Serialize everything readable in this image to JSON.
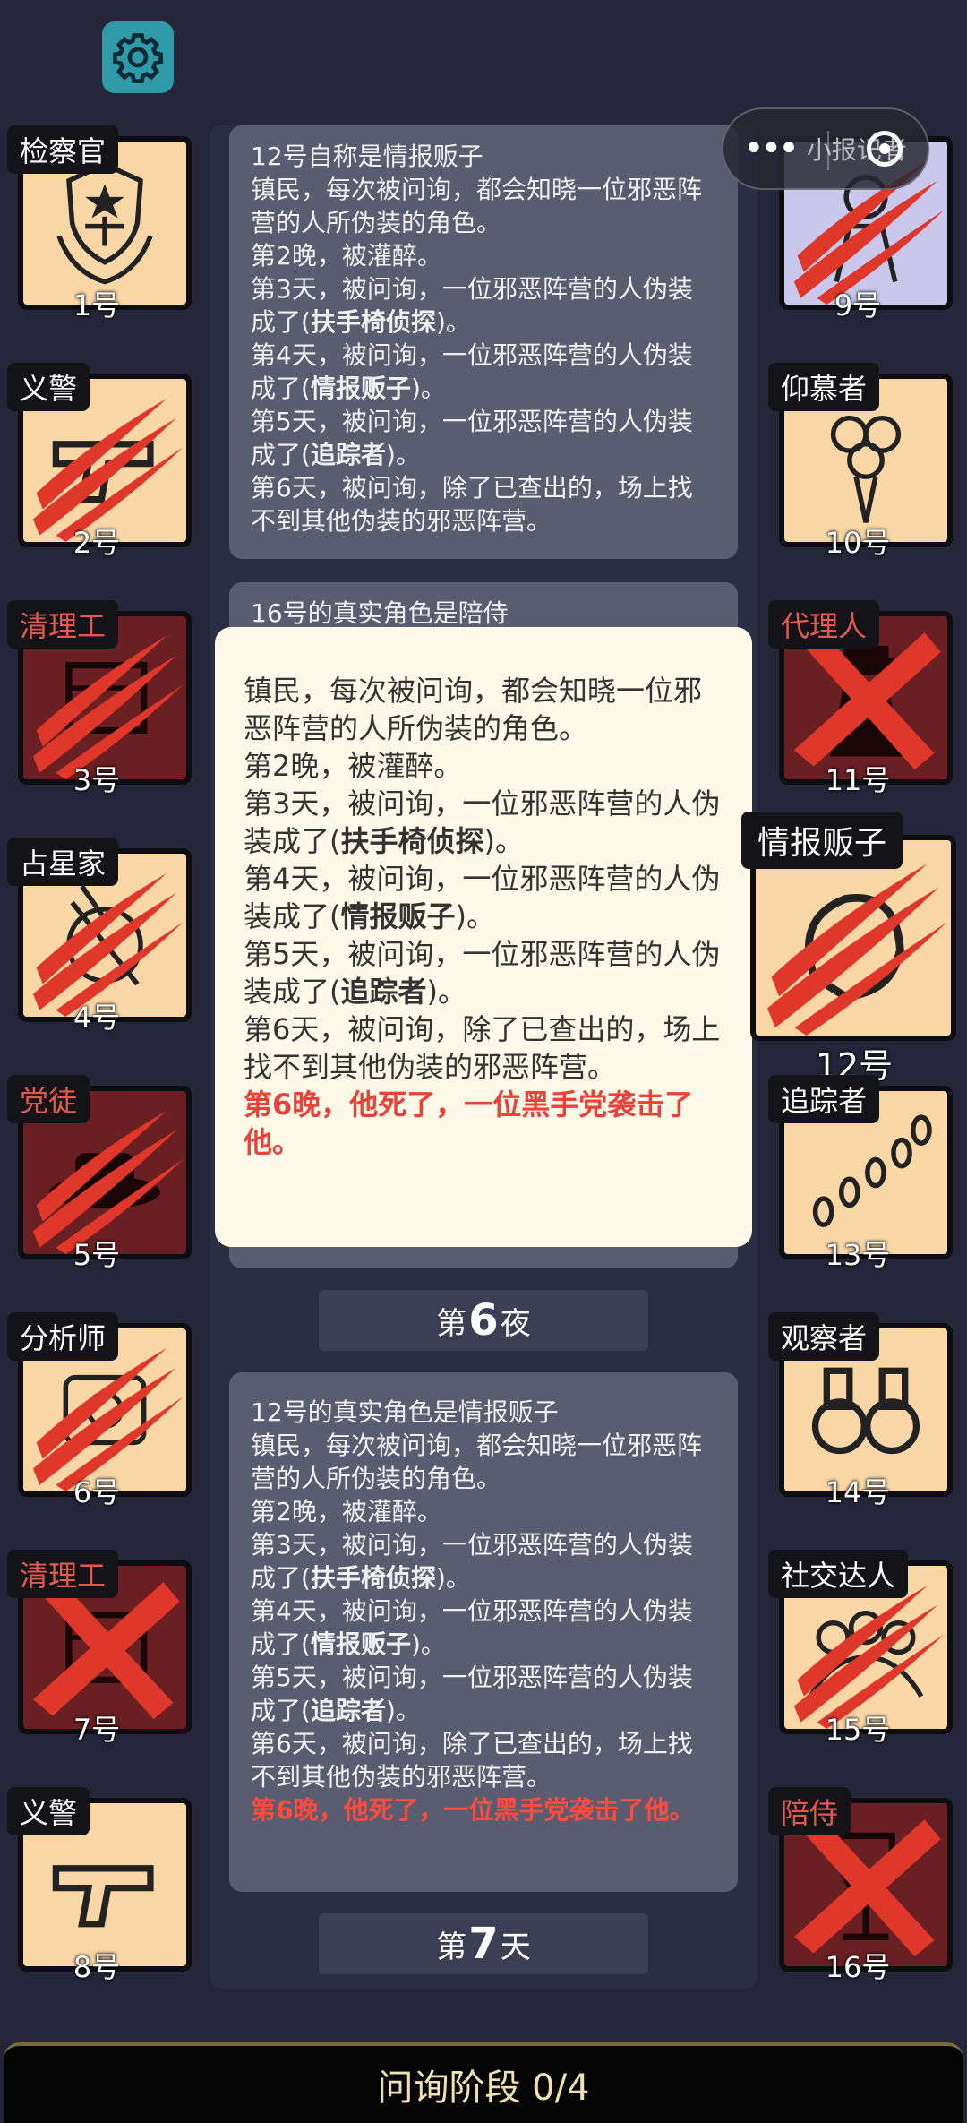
{
  "settings": {
    "icon": "gear-icon"
  },
  "mini_program": {
    "dots": "•••",
    "label": "小报记者",
    "icon": "record-icon"
  },
  "players_left": [
    {
      "seat": "1号",
      "role": "检察官",
      "state": "alive",
      "icon": "prosecutor-badge-icon"
    },
    {
      "seat": "2号",
      "role": "义警",
      "state": "clawed",
      "icon": "pistol-icon"
    },
    {
      "seat": "3号",
      "role": "清理工",
      "state": "clawed-evil",
      "icon": "cleaner-icon"
    },
    {
      "seat": "4号",
      "role": "占星家",
      "state": "clawed",
      "icon": "astrolabe-icon"
    },
    {
      "seat": "5号",
      "role": "党徒",
      "state": "clawed-evil",
      "icon": "hat-icon"
    },
    {
      "seat": "6号",
      "role": "分析师",
      "state": "clawed",
      "icon": "analyst-icon"
    },
    {
      "seat": "7号",
      "role": "清理工",
      "state": "executed-evil",
      "icon": "cleaner-icon"
    },
    {
      "seat": "8号",
      "role": "义警",
      "state": "alive",
      "icon": "pistol-icon"
    }
  ],
  "players_right": [
    {
      "seat": "9号",
      "role": "",
      "state": "clawed-violet",
      "icon": "figure-icon"
    },
    {
      "seat": "10号",
      "role": "仰慕者",
      "state": "alive",
      "icon": "bouquet-icon"
    },
    {
      "seat": "11号",
      "role": "代理人",
      "state": "executed-evil",
      "icon": "agent-icon"
    },
    {
      "seat": "12号",
      "role": "情报贩子",
      "state": "clawed-selected",
      "icon": "informant-icon"
    },
    {
      "seat": "13号",
      "role": "追踪者",
      "state": "alive",
      "icon": "footprints-icon"
    },
    {
      "seat": "14号",
      "role": "观察者",
      "state": "alive",
      "icon": "binoculars-icon"
    },
    {
      "seat": "15号",
      "role": "社交达人",
      "state": "clawed",
      "icon": "crowd-icon"
    },
    {
      "seat": "16号",
      "role": "陪侍",
      "state": "executed-evil",
      "icon": "wineglass-icon"
    }
  ],
  "log_top": {
    "line_claim": "12号自称是情报贩子",
    "line_desc": "镇民，每次被问询，都会知晓一位邪恶阵营的人所伪装的角色。",
    "line_n2": "第2晚，被灌醉。",
    "line_d3_a": "第3天，被问询，一位邪恶阵营的人伪装成了(",
    "line_d3_b": "扶手椅侦探",
    "line_d3_c": ")。",
    "line_d4_a": "第4天，被问询，一位邪恶阵营的人伪装成了(",
    "line_d4_b": "情报贩子",
    "line_d4_c": ")。",
    "line_d5_a": "第5天，被问询，一位邪恶阵营的人伪装成了(",
    "line_d5_b": "追踪者",
    "line_d5_c": ")。",
    "line_d6": "第6天，被问询，除了已查出的，场上找不到其他伪装的邪恶阵营。"
  },
  "log_mid_cut": "16号的真实角色是陪侍",
  "popup": {
    "line_desc": "镇民，每次被问询，都会知晓一位邪恶阵营的人所伪装的角色。",
    "line_n2": "第2晚，被灌醉。",
    "line_d3_a": "第3天，被问询，一位邪恶阵营的人伪装成了(",
    "line_d3_b": "扶手椅侦探",
    "line_d3_c": ")。",
    "line_d4_a": "第4天，被问询，一位邪恶阵营的人伪装成了(",
    "line_d4_b": "情报贩子",
    "line_d4_c": ")。",
    "line_d5_a": "第5天，被问询，一位邪恶阵营的人伪装成了(",
    "line_d5_b": "追踪者",
    "line_d5_c": ")。",
    "line_d6": "第6天，被问询，除了已查出的，场上找不到其他伪装的邪恶阵营。",
    "line_death": "第6晚，他死了，一位黑手党袭击了他。"
  },
  "banner_night": {
    "pre": "第",
    "num": "6",
    "post": "夜"
  },
  "log_bottom": {
    "line_true": "12号的真实角色是情报贩子",
    "line_desc": "镇民，每次被问询，都会知晓一位邪恶阵营的人所伪装的角色。",
    "line_n2": "第2晚，被灌醉。",
    "line_d3_a": "第3天，被问询，一位邪恶阵营的人伪装成了(",
    "line_d3_b": "扶手椅侦探",
    "line_d3_c": ")。",
    "line_d4_a": "第4天，被问询，一位邪恶阵营的人伪装成了(",
    "line_d4_b": "情报贩子",
    "line_d4_c": ")。",
    "line_d5_a": "第5天，被问询，一位邪恶阵营的人伪装成了(",
    "line_d5_b": "追踪者",
    "line_d5_c": ")。",
    "line_d6": "第6天，被问询，除了已查出的，场上找不到其他伪装的邪恶阵营。",
    "line_death": "第6晚，他死了，一位黑手党袭击了他。"
  },
  "banner_day": {
    "pre": "第",
    "num": "7",
    "post": "天"
  },
  "phase": {
    "label": "问询阶段 0/4"
  },
  "colors": {
    "claw": "#e0372b",
    "cross": "#e0372b",
    "tile": "#f8d6a6",
    "tile_dead": "#6a1f22",
    "evil_text": "#e5584f"
  }
}
